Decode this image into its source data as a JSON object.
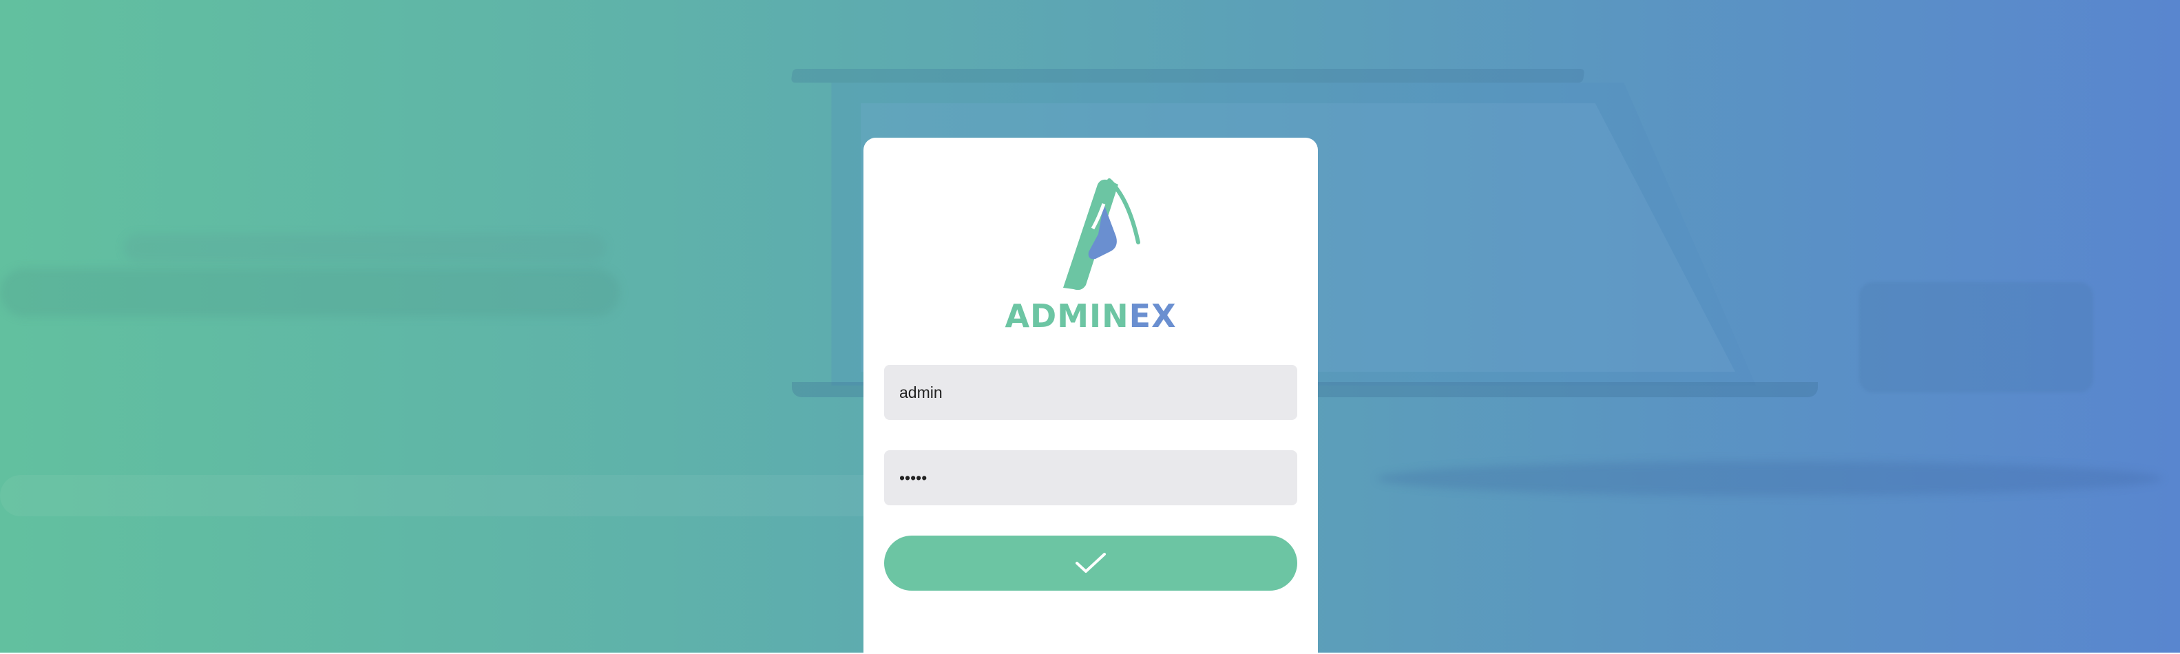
{
  "brand": {
    "name_part_1": "ADMIN",
    "name_part_2": "EX",
    "primary_color": "#6cc5a3",
    "secondary_color": "#6a8fd0",
    "logo_icon": "adminex-logo-icon"
  },
  "login": {
    "username_value": "admin",
    "password_value": "•••••",
    "submit_icon": "checkmark-icon"
  },
  "background": {
    "gradient_start": "#62c09f",
    "gradient_end": "#5986cf"
  }
}
